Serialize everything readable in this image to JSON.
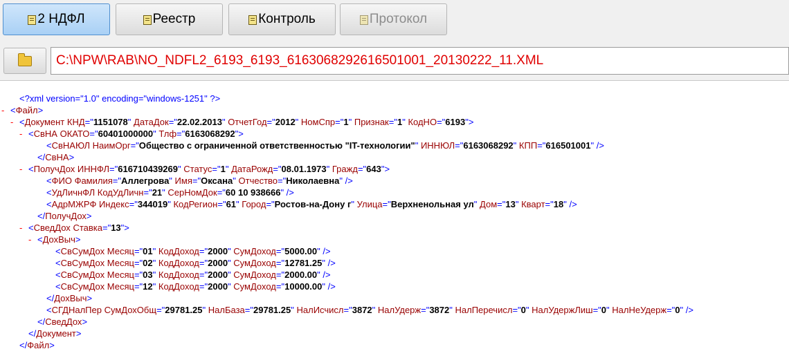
{
  "toolbar": {
    "buttons": [
      {
        "label": "2 НДФЛ",
        "state": "active"
      },
      {
        "label": "Реестр",
        "state": "normal"
      },
      {
        "label": "Контроль",
        "state": "normal"
      },
      {
        "label": "Протокол",
        "state": "disabled"
      }
    ]
  },
  "file": {
    "open_icon": "folder-open-icon",
    "path": "C:\\NPW\\RAB\\NO_NDFL2_6193_6193_6163068292616501001_20130222_11.XML"
  },
  "xml": {
    "lines": [
      {
        "indent": 2,
        "marker": "",
        "text": "<?xml version=\"1.0\" encoding=\"windows-1251\" ?>"
      },
      {
        "indent": 1,
        "marker": "-",
        "text": "<Файл>"
      },
      {
        "indent": 2,
        "marker": "-",
        "text": "<Документ КНД=\"1151078\" ДатаДок=\"22.02.2013\" ОтчетГод=\"2012\" НомСпр=\"1\" Признак=\"1\" КодНО=\"6193\">"
      },
      {
        "indent": 3,
        "marker": "-",
        "text": "<СвНА ОКАТО=\"60401000000\" Тлф=\"6163068292\">"
      },
      {
        "indent": 5,
        "marker": "",
        "text": "<СвНАЮЛ НаимОрг=\"Общество с ограниченной ответственностью \"IT-технологии\"\" ИННЮЛ=\"6163068292\" КПП=\"616501001\" />"
      },
      {
        "indent": 4,
        "marker": "",
        "text": "</СвНА>"
      },
      {
        "indent": 3,
        "marker": "-",
        "text": "<ПолучДох ИННФЛ=\"616710439269\" Статус=\"1\" ДатаРожд=\"08.01.1973\" Гражд=\"643\">"
      },
      {
        "indent": 5,
        "marker": "",
        "text": "<ФИО Фамилия=\"Аллегрова\" Имя=\"Оксана\" Отчество=\"Николаевна\" />"
      },
      {
        "indent": 5,
        "marker": "",
        "text": "<УдЛичнФЛ КодУдЛичн=\"21\" СерНомДок=\"60 10 938666\" />"
      },
      {
        "indent": 5,
        "marker": "",
        "text": "<АдрМЖРФ Индекс=\"344019\" КодРегион=\"61\" Город=\"Ростов-на-Дону г\" Улица=\"Верхненольная ул\" Дом=\"13\" Кварт=\"18\" />"
      },
      {
        "indent": 4,
        "marker": "",
        "text": "</ПолучДох>"
      },
      {
        "indent": 3,
        "marker": "-",
        "text": "<СведДох Ставка=\"13\">"
      },
      {
        "indent": 4,
        "marker": "-",
        "text": "<ДохВыч>"
      },
      {
        "indent": 6,
        "marker": "",
        "text": "<СвСумДох Месяц=\"01\" КодДоход=\"2000\" СумДоход=\"5000.00\" />"
      },
      {
        "indent": 6,
        "marker": "",
        "text": "<СвСумДох Месяц=\"02\" КодДоход=\"2000\" СумДоход=\"12781.25\" />"
      },
      {
        "indent": 6,
        "marker": "",
        "text": "<СвСумДох Месяц=\"03\" КодДоход=\"2000\" СумДоход=\"2000.00\" />"
      },
      {
        "indent": 6,
        "marker": "",
        "text": "<СвСумДох Месяц=\"12\" КодДоход=\"2000\" СумДоход=\"10000.00\" />"
      },
      {
        "indent": 5,
        "marker": "",
        "text": "</ДохВыч>"
      },
      {
        "indent": 5,
        "marker": "",
        "text": "<СГДНалПер СумДохОбщ=\"29781.25\" НалБаза=\"29781.25\" НалИсчисл=\"3872\" НалУдерж=\"3872\" НалПеречисл=\"0\" НалУдержЛиш=\"0\" НалНеУдерж=\"0\" />"
      },
      {
        "indent": 4,
        "marker": "",
        "text": "</СведДох>"
      },
      {
        "indent": 3,
        "marker": "",
        "text": "</Документ>"
      },
      {
        "indent": 2,
        "marker": "",
        "text": "</Файл>"
      }
    ]
  }
}
